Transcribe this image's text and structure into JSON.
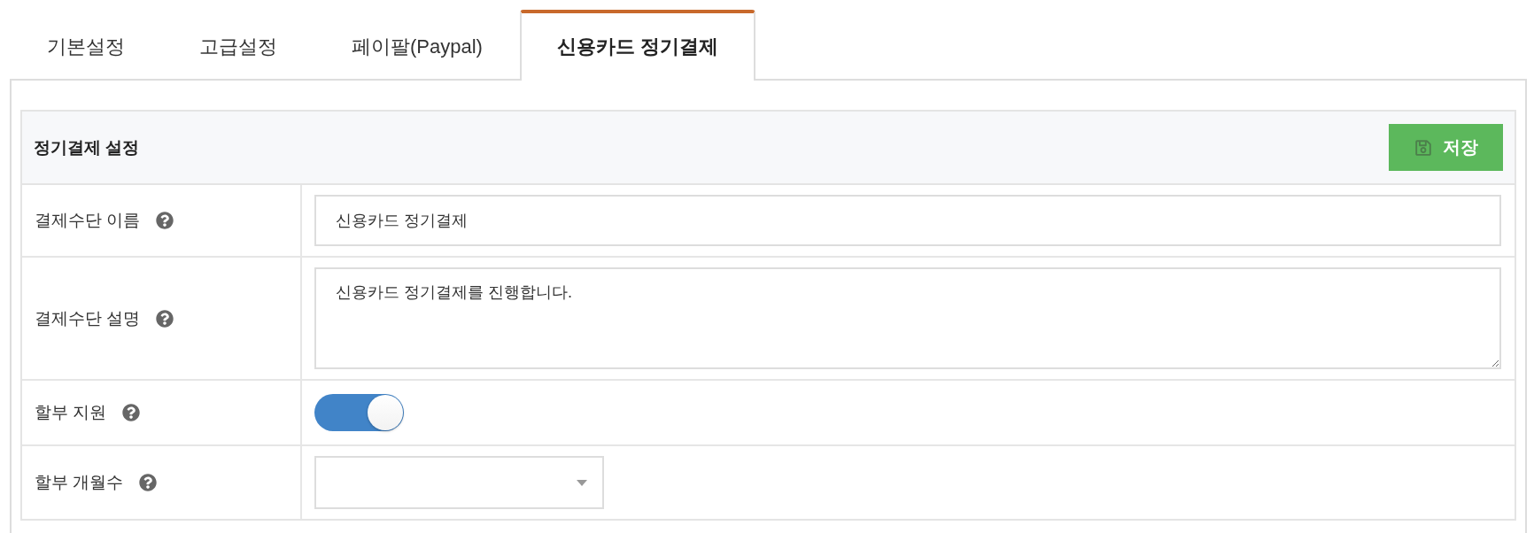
{
  "tabs": [
    {
      "label": "기본설정",
      "selected": false
    },
    {
      "label": "고급설정",
      "selected": false
    },
    {
      "label": "페이팔(Paypal)",
      "selected": false
    },
    {
      "label": "신용카드 정기결제",
      "selected": true
    }
  ],
  "card": {
    "title": "정기결제 설정",
    "save_button": "저장"
  },
  "fields": [
    {
      "kind": "text",
      "label": "결제수단 이름",
      "value": "신용카드 정기결제"
    },
    {
      "kind": "textarea",
      "label": "결제수단 설명",
      "value": "신용카드 정기결제를 진행합니다."
    },
    {
      "kind": "toggle",
      "label": "할부 지원",
      "on": true
    },
    {
      "kind": "select",
      "label": "할부 개월수"
    }
  ]
}
